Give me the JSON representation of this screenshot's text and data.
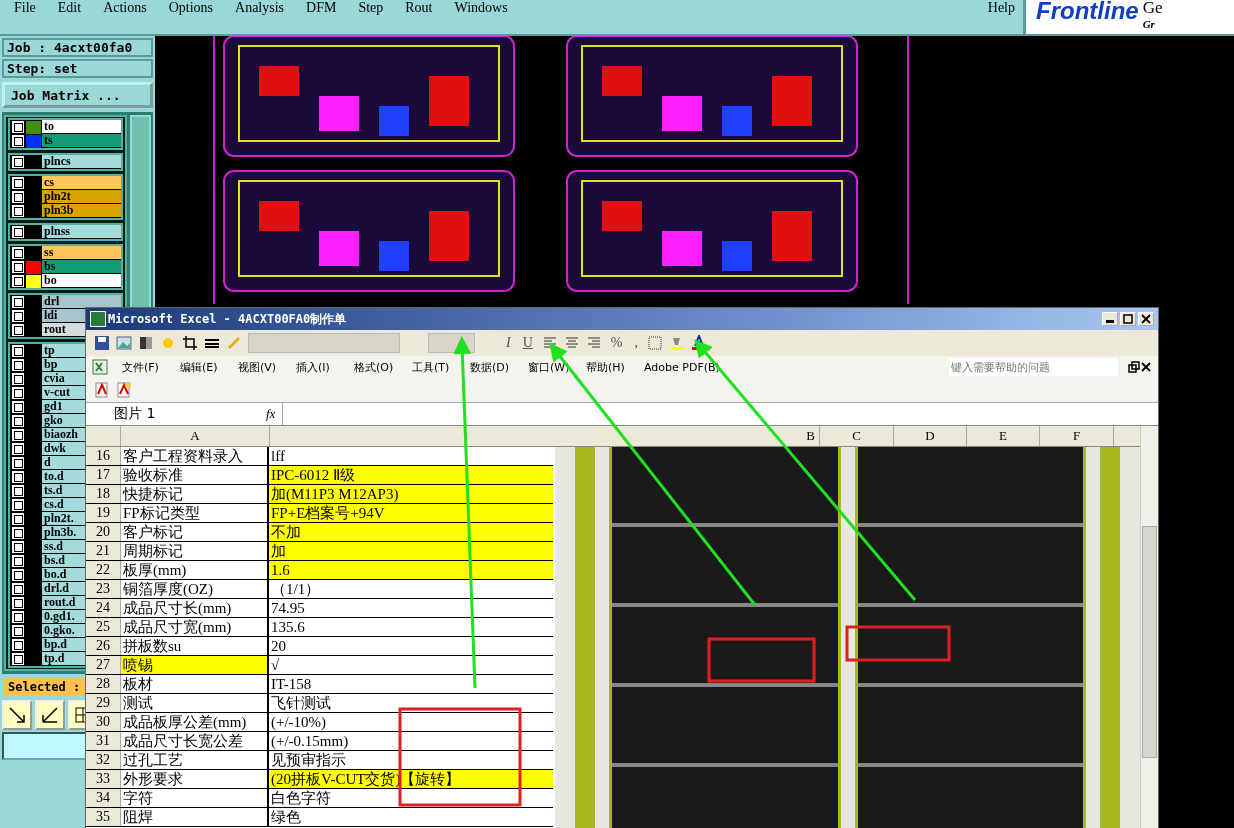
{
  "app_menu": {
    "items": [
      "File",
      "Edit",
      "Actions",
      "Options",
      "Analysis",
      "DFM",
      "Step",
      "Rout",
      "Windows"
    ],
    "help": "Help"
  },
  "logo": {
    "name": "Frontline",
    "cut_top": "Ge",
    "cut_bottom": "Gr"
  },
  "job": "Job : 4acxt00fa0",
  "step": "Step: set",
  "job_matrix_button": "Job Matrix ...",
  "layer_groups": [
    {
      "layers": [
        {
          "name": "to",
          "color": "#ffffff",
          "checked": false,
          "swatch": {
            "color": "#3f8f10"
          }
        },
        {
          "name": "ts",
          "color": "#139a76",
          "checked": false,
          "swatch": {
            "color": "#0030ff"
          }
        }
      ]
    },
    {
      "layers": [
        {
          "name": "plncs",
          "color": "#a4dcdc",
          "checked": false
        }
      ]
    },
    {
      "layers": [
        {
          "name": "cs",
          "color": "#ffc658",
          "checked": false
        },
        {
          "name": "pln2t",
          "color": "#d8a400",
          "checked": false
        },
        {
          "name": "pln3b",
          "color": "#d8a400",
          "checked": false
        }
      ]
    },
    {
      "layers": [
        {
          "name": "plnss",
          "color": "#a4dcdc",
          "checked": false
        }
      ]
    },
    {
      "layers": [
        {
          "name": "ss",
          "color": "#ffc658",
          "checked": false
        },
        {
          "name": "bs",
          "color": "#139a76",
          "checked": false,
          "swatch": {
            "color": "#ff0000"
          }
        },
        {
          "name": "bo",
          "color": "#ffffff",
          "checked": false,
          "swatch": {
            "color": "#ffff20"
          }
        }
      ]
    },
    {
      "layers": [
        {
          "name": "drl",
          "color": "#a8c4cc",
          "checked": false
        },
        {
          "name": "ldi",
          "color": "#a8c4cc",
          "checked": false
        },
        {
          "name": "rout",
          "color": "#d4dcdc",
          "checked": false
        }
      ]
    },
    {
      "layers": [
        {
          "name": "tp",
          "color": "#a4dcdc",
          "checked": false
        },
        {
          "name": "bp",
          "color": "#a4dcdc",
          "checked": false
        },
        {
          "name": "cvia",
          "color": "#a4dcdc",
          "checked": false
        },
        {
          "name": "v-cut",
          "color": "#a4dcdc",
          "checked": false
        },
        {
          "name": "gd1",
          "color": "#a4dcdc",
          "checked": false
        },
        {
          "name": "gko",
          "color": "#a4dcdc",
          "checked": false
        },
        {
          "name": "biaozh",
          "color": "#a4dcdc",
          "checked": false
        },
        {
          "name": "dwk",
          "color": "#a4dcdc",
          "checked": false
        },
        {
          "name": "d",
          "color": "#a4dcdc",
          "checked": false
        },
        {
          "name": "to.d",
          "color": "#a4dcdc",
          "checked": false
        },
        {
          "name": "ts.d",
          "color": "#a4dcdc",
          "checked": false
        },
        {
          "name": "cs.d",
          "color": "#a4dcdc",
          "checked": false
        },
        {
          "name": "pln2t.",
          "color": "#a4dcdc",
          "checked": false
        },
        {
          "name": "pln3b.",
          "color": "#a4dcdc",
          "checked": false
        },
        {
          "name": "ss.d",
          "color": "#a4dcdc",
          "checked": false
        },
        {
          "name": "bs.d",
          "color": "#a4dcdc",
          "checked": false
        },
        {
          "name": "bo.d",
          "color": "#a4dcdc",
          "checked": false
        },
        {
          "name": "drl.d",
          "color": "#a4dcdc",
          "checked": false
        },
        {
          "name": "rout.d",
          "color": "#a4dcdc",
          "checked": false
        },
        {
          "name": "0.gd1.",
          "color": "#a4dcdc",
          "checked": false
        },
        {
          "name": "0.gko.",
          "color": "#a4dcdc",
          "checked": false
        },
        {
          "name": "bp.d",
          "color": "#a4dcdc",
          "checked": false
        },
        {
          "name": "tp.d",
          "color": "#a4dcdc",
          "checked": false
        }
      ]
    }
  ],
  "selected_label": "Selected :",
  "excel": {
    "title": "Microsoft Excel - 4ACXT00FA0制作单",
    "format_buttons": [
      "I",
      "U"
    ],
    "number_buttons": [
      "%",
      ","
    ],
    "menu": [
      "文件(F)",
      "编辑(E)",
      "视图(V)",
      "插入(I)",
      "格式(O)",
      "工具(T)",
      "数据(D)",
      "窗口(W)",
      "帮助(H)",
      "Adobe PDF(B)"
    ],
    "help_placeholder": "键入需要帮助的问题",
    "name_box": "图片 1",
    "fx": "fx",
    "columns": [
      "A",
      "B",
      "C",
      "D",
      "E",
      "F"
    ],
    "rows": [
      {
        "num": "16",
        "label": "客户工程资料录入",
        "value": "lff",
        "label_highlight": false,
        "value_highlight": false
      },
      {
        "num": "17",
        "label": "验收标准",
        "value": "IPC-6012 Ⅱ级",
        "label_highlight": false,
        "value_highlight": true
      },
      {
        "num": "18",
        "label": "快捷标记",
        "value": "加(M11P3 M12AP3)",
        "label_highlight": false,
        "value_highlight": true
      },
      {
        "num": "19",
        "label": "FP标记类型",
        "value": "FP+E档案号+94V",
        "label_highlight": false,
        "value_highlight": true
      },
      {
        "num": "20",
        "label": "客户标记",
        "value": "不加",
        "label_highlight": false,
        "value_highlight": true
      },
      {
        "num": "21",
        "label": "周期标记",
        "value": "加",
        "label_highlight": false,
        "value_highlight": true
      },
      {
        "num": "22",
        "label": "板厚(mm)",
        "value": "1.6",
        "label_highlight": false,
        "value_highlight": true
      },
      {
        "num": "23",
        "label": "铜箔厚度(OZ)",
        "value": "（1/1）",
        "label_highlight": false,
        "value_highlight": false
      },
      {
        "num": "24",
        "label": "成品尺寸长(mm)",
        "value": "74.95",
        "label_highlight": false,
        "value_highlight": false
      },
      {
        "num": "25",
        "label": "成品尺寸宽(mm)",
        "value": "135.6",
        "label_highlight": false,
        "value_highlight": false
      },
      {
        "num": "26",
        "label": "拼板数su",
        "value": "20",
        "label_highlight": false,
        "value_highlight": false
      },
      {
        "num": "27",
        "label": "喷锡",
        "value": "√",
        "label_highlight": true,
        "value_highlight": false
      },
      {
        "num": "28",
        "label": "板材",
        "value": "IT-158",
        "label_highlight": false,
        "value_highlight": false
      },
      {
        "num": "29",
        "label": "测试",
        "value": "飞针测试",
        "label_highlight": false,
        "value_highlight": false
      },
      {
        "num": "30",
        "label": "成品板厚公差(mm)",
        "value": "(+/-10%)",
        "label_highlight": false,
        "value_highlight": false
      },
      {
        "num": "31",
        "label": "成品尺寸长宽公差",
        "value": "(+/-0.15mm)",
        "label_highlight": false,
        "value_highlight": false
      },
      {
        "num": "32",
        "label": "过孔工艺",
        "value": "见预审指示",
        "label_highlight": false,
        "value_highlight": false
      },
      {
        "num": "33",
        "label": "外形要求",
        "value": "(20拼板V-CUT交货)【旋转】",
        "label_highlight": false,
        "value_highlight": true
      },
      {
        "num": "34",
        "label": "字符",
        "value": "白色字符",
        "label_highlight": false,
        "value_highlight": false
      },
      {
        "num": "35",
        "label": "阻焊",
        "value": "绿色",
        "label_highlight": false,
        "value_highlight": false
      }
    ]
  }
}
